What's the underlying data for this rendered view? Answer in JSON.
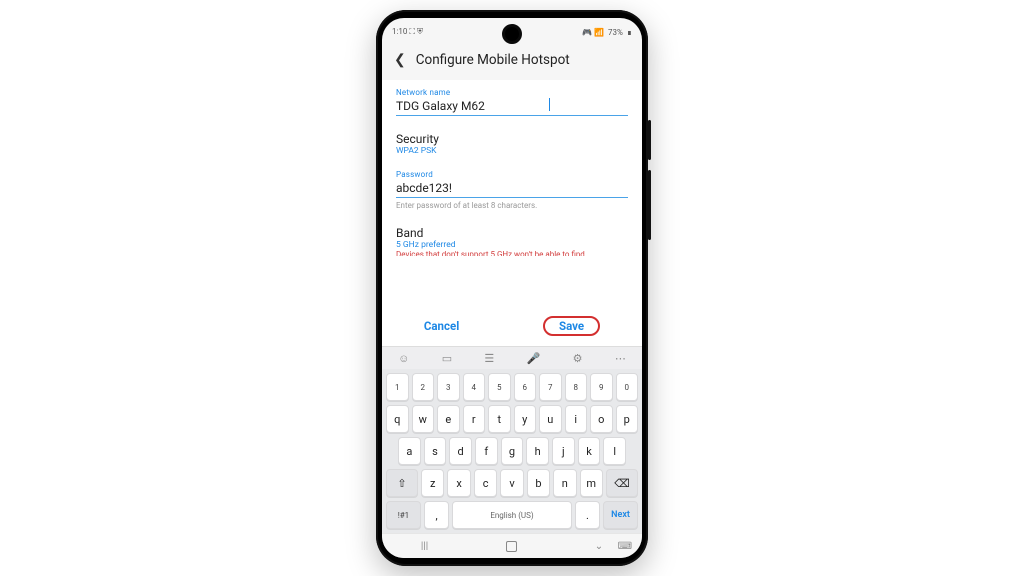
{
  "status": {
    "time": "1:10",
    "left_icons": "⛶ ⛨",
    "right_icons": "🎮 📶",
    "battery": "73%"
  },
  "header": {
    "title": "Configure Mobile Hotspot"
  },
  "form": {
    "net_label": "Network name",
    "net_value": "TDG Galaxy M62",
    "sec_label": "Security",
    "sec_value": "WPA2 PSK",
    "pwd_label": "Password",
    "pwd_value": "abcde123!",
    "pwd_hint": "Enter password of at least 8 characters.",
    "band_label": "Band",
    "band_value": "5 GHz preferred",
    "band_warn": "Devices that don't support 5 GHz won't be able to find"
  },
  "actions": {
    "cancel": "Cancel",
    "save": "Save"
  },
  "keyboard": {
    "row1": [
      "1",
      "2",
      "3",
      "4",
      "5",
      "6",
      "7",
      "8",
      "9",
      "0"
    ],
    "row2": [
      "q",
      "w",
      "e",
      "r",
      "t",
      "y",
      "u",
      "i",
      "o",
      "p"
    ],
    "row3": [
      "a",
      "s",
      "d",
      "f",
      "g",
      "h",
      "j",
      "k",
      "l"
    ],
    "row4": [
      "z",
      "x",
      "c",
      "v",
      "b",
      "n",
      "m"
    ],
    "shift": "⇧",
    "back": "⌫",
    "sym": "!#1",
    "comma": ",",
    "period": ".",
    "space": "English (US)",
    "next": "Next",
    "tb1": "☺",
    "tb2": "▭",
    "tb3": "☰",
    "tb4": "🎤",
    "tb5": "⚙",
    "tb6": "⋯"
  },
  "nav": {
    "recent": "|||",
    "home": "",
    "back": "⌄",
    "kb": "⌨"
  }
}
